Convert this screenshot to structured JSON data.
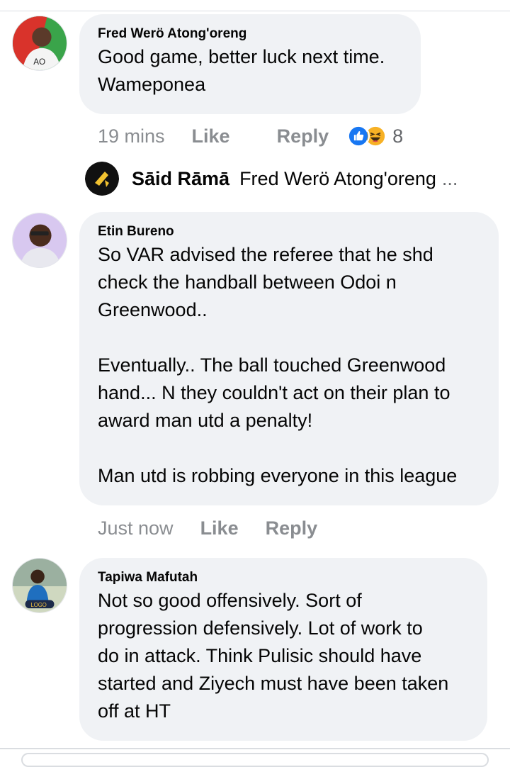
{
  "comments": [
    {
      "author": "Fred Werö Atong'oreng",
      "text": "Good game, better luck next time.\nWameponea",
      "time": "19 mins",
      "like_label": "Like",
      "reply_label": "Reply",
      "reaction_icons": [
        "like-icon",
        "haha-icon"
      ],
      "reaction_count": "8",
      "reply_preview": {
        "author": "Sāid Rāmā",
        "snippet": "Fred Werö Atong'oreng",
        "ellipsis": "..."
      }
    },
    {
      "author": "Etin Bureno",
      "text": "So VAR advised the referee that he shd\ncheck the handball between Odoi n\nGreenwood..\n\nEventually.. The ball touched Greenwood\nhand... N they couldn't act on their plan to\naward man utd a penalty!\n\nMan utd is robbing everyone in this league",
      "time": "Just now",
      "like_label": "Like",
      "reply_label": "Reply"
    },
    {
      "author": "Tapiwa Mafutah",
      "text": "Not so good offensively. Sort of\nprogression defensively. Lot of work to\ndo in attack. Think Pulisic should have\nstarted and Ziyech must have been taken\noff at HT"
    }
  ],
  "colors": {
    "bubble": "#f0f2f5",
    "meta_text": "#8a8d91",
    "like_blue": "#1877f2",
    "haha_yellow": "#f7b125"
  }
}
